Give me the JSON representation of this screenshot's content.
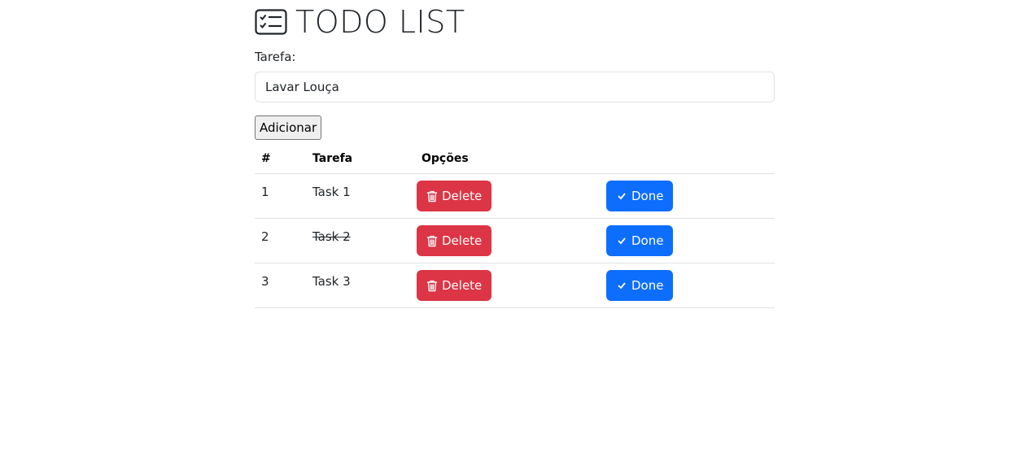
{
  "header": {
    "title": "TODO LIST",
    "icon": "task-list-icon"
  },
  "form": {
    "label": "Tarefa:",
    "input_value": "Lavar Louça",
    "add_label": "Adicionar"
  },
  "table": {
    "headers": [
      "#",
      "Tarefa",
      "Opções"
    ],
    "rows": [
      {
        "num": "1",
        "task": "Task 1",
        "done": false
      },
      {
        "num": "2",
        "task": "Task 2",
        "done": true
      },
      {
        "num": "3",
        "task": "Task 3",
        "done": false
      }
    ],
    "delete_label": "Delete",
    "done_label": "Done"
  },
  "colors": {
    "danger": "#dc3545",
    "primary": "#0d6efd"
  }
}
